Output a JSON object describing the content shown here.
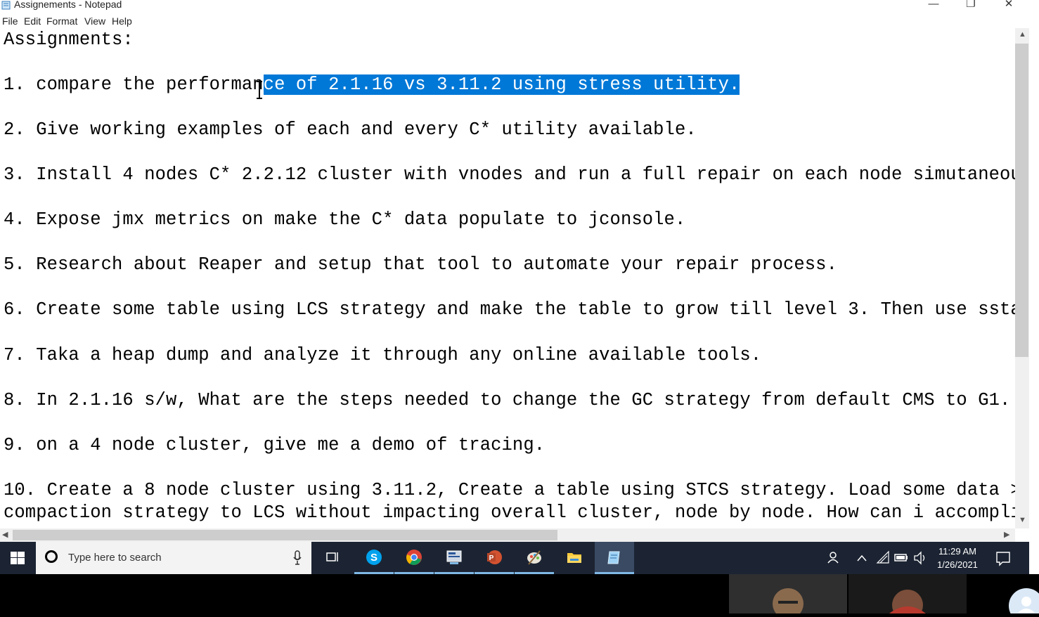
{
  "window": {
    "title": "Assignements - Notepad",
    "controls": {
      "minimize": "—",
      "restore": "❐",
      "close": "✕"
    }
  },
  "menu": [
    "File",
    "Edit",
    "Format",
    "View",
    "Help"
  ],
  "document": {
    "heading": "Assignments:",
    "line1_before": "1. compare the performan",
    "line1_selected": "ce of 2.1.16 vs 3.11.2 using stress utility.",
    "lines": [
      "2. Give working examples of each and every C* utility available.",
      "3. Install 4 nodes C* 2.2.12 cluster with vnodes and run a full repair on each node simutaneou",
      "4. Expose jmx metrics on make the C* data populate to jconsole.",
      "5. Research about Reaper and setup that tool to automate your repair process.",
      "6. Create some table using LCS strategy and make the table to grow till level 3. Then use ssta",
      "7. Taka a heap dump and analyze it through any online available tools.",
      "8. In 2.1.16 s/w, What are the steps needed to change the GC strategy from default CMS to G1.",
      "9. on a 4 node cluster, give me a demo of tracing.",
      "10. Create a 8 node cluster using 3.11.2, Create a table using STCS strategy. Load some data >",
      "compaction strategy to LCS without impacting overall cluster, node by node. How can i accompli"
    ]
  },
  "taskbar": {
    "search_placeholder": "Type here to search",
    "apps": [
      "task-view",
      "skype",
      "chrome",
      "sql-tool",
      "powerpoint",
      "paint",
      "file-explorer",
      "notepad"
    ],
    "clock_time": "11:29 AM",
    "clock_date": "1/26/2021"
  },
  "colors": {
    "selection": "#0078d7",
    "taskbar": "#1c2433",
    "active_underline": "#7fb8e6"
  }
}
